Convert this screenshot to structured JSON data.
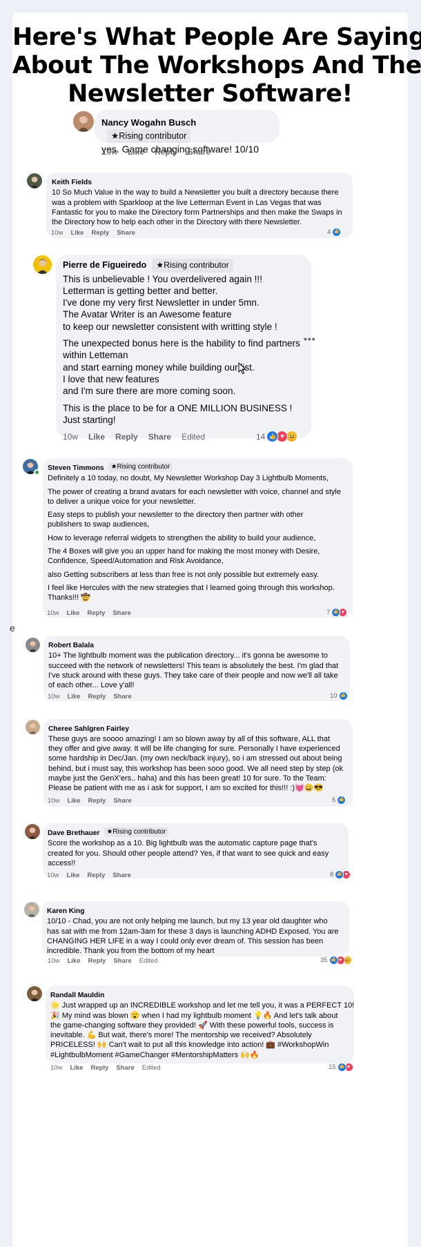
{
  "page": {
    "headline": [
      "Here's What People Are Saying",
      "About The Workshops And The",
      "Newsletter Software!"
    ],
    "edge_char": "e"
  },
  "actions": {
    "like": "Like",
    "reply": "Reply",
    "share": "Share",
    "edited": "Edited"
  },
  "badge_label": "Rising contributor",
  "colors": {
    "like": "#1877f2",
    "love": "#f33e58",
    "haha": "#f7b125",
    "bubble": "#f0f2f5",
    "meta": "#65676b"
  },
  "comments": [
    {
      "name": "Nancy Wogahn Busch",
      "badge": true,
      "time": "10w",
      "paragraphs": [
        [
          "yes. Game changing software! 10/10"
        ]
      ],
      "reactions": null
    },
    {
      "name": "Keith Fields",
      "badge": false,
      "time": "10w",
      "paragraphs": [
        [
          "10 So Much Value in the way to build a Newsletter you built a directory because there",
          "was a problem with Sparkloop at the live Letterman Event in Las Vegas that was",
          "Fantastic for you to make the Directory form Partnerships and then make the Swaps in",
          "the Directory how to help each other in the Directory with there Newsletter."
        ]
      ],
      "reactions": {
        "count": "4",
        "icons": [
          "like-icon"
        ]
      }
    },
    {
      "name": "Pierre de Figueiredo",
      "badge": true,
      "time": "10w",
      "edited": true,
      "paragraphs": [
        [
          "This is unbelievable ! You overdelivered again !!!",
          "Letterman is getting better and better.",
          "I've done my very first Newsletter in under 5mn.",
          "The Avatar Writer is an Awesome feature",
          "to keep our newsletter consistent with writting style !"
        ],
        [
          "The unexpected bonus here is the hability to find partners",
          "within Letteman",
          "and start earning money while building our list.",
          "I love that new features",
          "and I'm sure there are more coming soon."
        ],
        [
          "This is the place to be for a ONE MILLION BUSINESS !",
          "Just starting!"
        ]
      ],
      "reactions": {
        "count": "14",
        "icons": [
          "like-icon",
          "love-icon",
          "haha-icon"
        ]
      }
    },
    {
      "name": "Steven Timmons",
      "badge": true,
      "time": "10w",
      "paragraphs": [
        [
          "Definitely a 10 today, no doubt, My Newsletter Workshop Day 3 Lightbulb Moments,"
        ],
        [
          "The power of creating a brand avatars for each newsletter with voice, channel and style",
          "to deliver a unique voice for your newsletter."
        ],
        [
          "Easy steps to publish your newsletter to the directory then partner with other",
          "publishers to swap audiences,"
        ],
        [
          "How to leverage referral widgets to strengthen the ability to build your audience,"
        ],
        [
          "The 4 Boxes will give you an upper hand for making the most money with Desire,",
          "Confidence, Speed/Automation and Risk Avoidance,"
        ],
        [
          "also Getting subscribers at less than free is not only possible but extremely easy."
        ],
        [
          "I feel like Hercules with the new strategies that I learned going through this workshop.",
          "Thanks!!! 🤠"
        ]
      ],
      "reactions": {
        "count": "7",
        "icons": [
          "like-icon",
          "love-icon"
        ]
      }
    },
    {
      "name": "Robert Balala",
      "badge": false,
      "time": "10w",
      "paragraphs": [
        [
          "10+ The lightbulb moment was the publication directory... it's gonna be awesome to",
          "succeed with the network of newsletters! This team is absolutely the best. I'm glad that",
          "I've stuck around with these guys. They take care of their people and now we'll all take",
          "of each other... Love y'all!"
        ]
      ],
      "reactions": {
        "count": "10",
        "icons": [
          "like-icon"
        ]
      }
    },
    {
      "name": "Cheree Sahlgren Fairley",
      "badge": false,
      "time": "10w",
      "paragraphs": [
        [
          "These guys are soooo amazing! I am so blown away by all of this software, ALL that",
          "they offer and give away. It will be life changing for sure. Personally I have experienced",
          "some hardship in Dec/Jan. (my own neck/back injury), so i am stressed out about being",
          "behind, but i must say, this workshop has been sooo good. We all need step by step (ok",
          "maybe just the GenX'ers.. haha) and this has been great! 10 for sure. To the Team:",
          "Please be patient with me as i ask for support, I am so excited for this!!! :)💓😀😎"
        ]
      ],
      "reactions": {
        "count": "5",
        "icons": [
          "like-icon"
        ]
      }
    },
    {
      "name": "Dave Brethauer",
      "badge": true,
      "time": "10w",
      "paragraphs": [
        [
          "Score the workshop as a 10. Big lightbulb was the automatic capture page that's",
          "created for you. Should other people attend? Yes, if that want to see quick and easy",
          "access!!"
        ]
      ],
      "reactions": {
        "count": "8",
        "icons": [
          "like-icon",
          "love-icon"
        ]
      }
    },
    {
      "name": "Karen King",
      "badge": false,
      "time": "10w",
      "edited": true,
      "paragraphs": [
        [
          "10/10 - Chad, you are not only helping me launch, but my 13 year old daughter who",
          "has sat with me from 12am-3am for these 3 days is launching ADHD Exposed. You are",
          "CHANGING HER LIFE in a way I could only ever dream of. This session has been",
          "incredible. Thank you from the bottom of my heart"
        ]
      ],
      "reactions": {
        "count": "35",
        "icons": [
          "like-icon",
          "love-icon",
          "haha-icon"
        ]
      }
    },
    {
      "name": "Randall Mauldin",
      "badge": false,
      "time": "10w",
      "edited": true,
      "paragraphs": [
        [
          "🌟 Just wrapped up an INCREDIBLE workshop and let me tell you, it was a PERFECT 10!",
          "🎉 My mind was blown 😮 when I had my lightbulb moment 💡🔥 And let's talk about",
          "the game-changing software they provided! 🚀 With these powerful tools, success is",
          "inevitable. 💪 But wait, there's more! The mentorship we received? Absolutely",
          "PRICELESS! 🙌 Can't wait to put all this knowledge into action! 💼 #WorkshopWin",
          "#LightbulbMoment #GameChanger #MentorshipMatters 🙌🔥"
        ]
      ],
      "reactions": {
        "count": "15",
        "icons": [
          "like-icon",
          "love-icon"
        ]
      }
    }
  ]
}
